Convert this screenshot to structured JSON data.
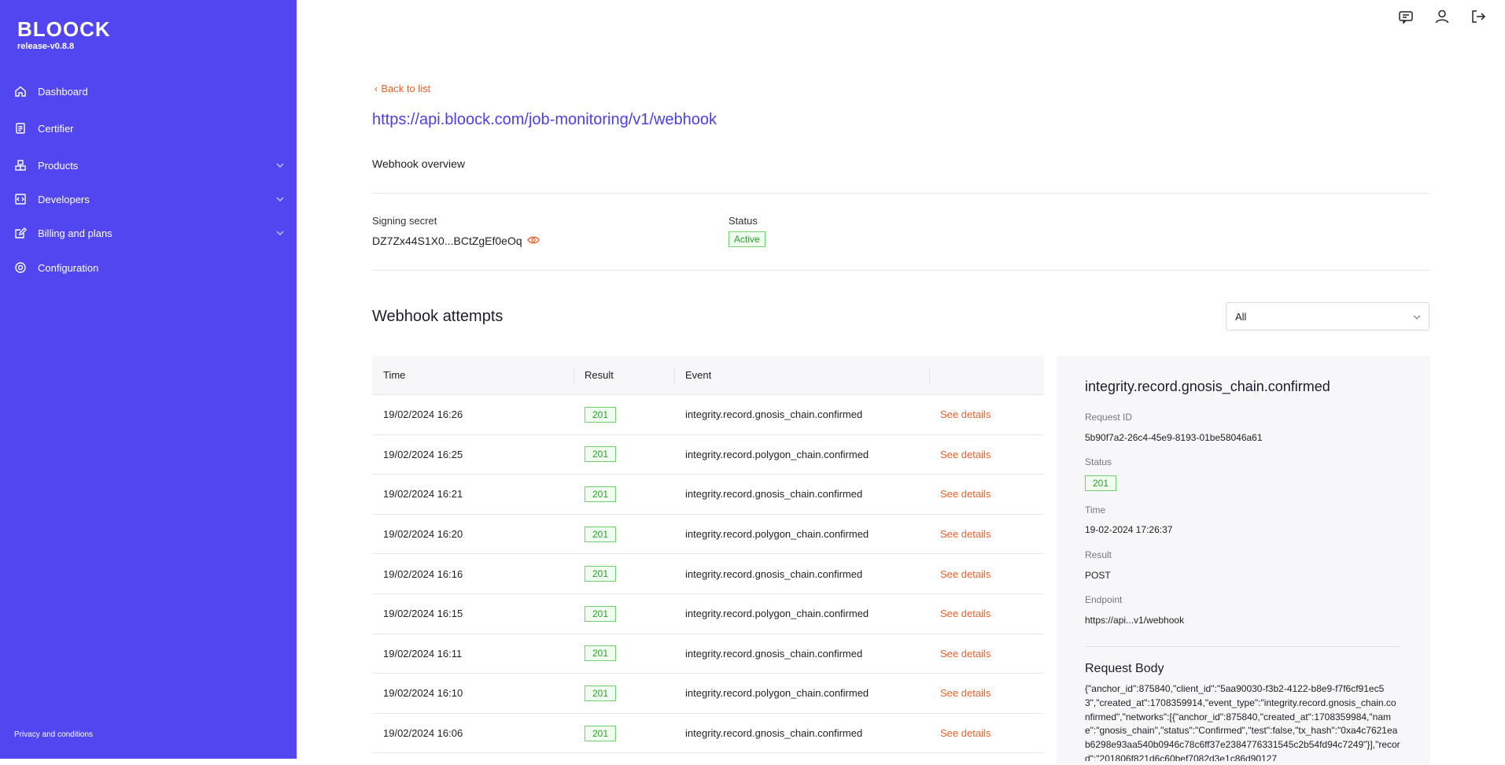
{
  "sidebar": {
    "logo": "BLOOCK",
    "version": "release-v0.8.8",
    "items": [
      {
        "label": "Dashboard",
        "icon": "home-icon",
        "expandable": false
      },
      {
        "label": "Certifier",
        "icon": "document-icon",
        "expandable": false
      },
      {
        "label": "Products",
        "icon": "cubes-icon",
        "expandable": true
      },
      {
        "label": "Developers",
        "icon": "code-icon",
        "expandable": true
      },
      {
        "label": "Billing and plans",
        "icon": "edit-icon",
        "expandable": true
      },
      {
        "label": "Configuration",
        "icon": "gear-icon",
        "expandable": false
      }
    ],
    "footer": "Privacy and conditions"
  },
  "topbar": {
    "icons": [
      "chat-icon",
      "user-icon",
      "logout-icon"
    ]
  },
  "main": {
    "back_label": "Back to list",
    "title": "https://api.bloock.com/job-monitoring/v1/webhook",
    "overview_title": "Webhook overview",
    "signing_secret_label": "Signing secret",
    "signing_secret_value": "DZ7Zx44S1X0...BCtZgEf0eOq",
    "status_label": "Status",
    "status_value": "Active",
    "attempts_title": "Webhook attempts",
    "filter": {
      "selected": "All"
    }
  },
  "table": {
    "headers": {
      "time": "Time",
      "result": "Result",
      "event": "Event"
    },
    "action_label": "See details",
    "rows": [
      {
        "time": "19/02/2024 16:26",
        "result": "201",
        "event": "integrity.record.gnosis_chain.confirmed"
      },
      {
        "time": "19/02/2024 16:25",
        "result": "201",
        "event": "integrity.record.polygon_chain.confirmed"
      },
      {
        "time": "19/02/2024 16:21",
        "result": "201",
        "event": "integrity.record.gnosis_chain.confirmed"
      },
      {
        "time": "19/02/2024 16:20",
        "result": "201",
        "event": "integrity.record.polygon_chain.confirmed"
      },
      {
        "time": "19/02/2024 16:16",
        "result": "201",
        "event": "integrity.record.gnosis_chain.confirmed"
      },
      {
        "time": "19/02/2024 16:15",
        "result": "201",
        "event": "integrity.record.polygon_chain.confirmed"
      },
      {
        "time": "19/02/2024 16:11",
        "result": "201",
        "event": "integrity.record.gnosis_chain.confirmed"
      },
      {
        "time": "19/02/2024 16:10",
        "result": "201",
        "event": "integrity.record.polygon_chain.confirmed"
      },
      {
        "time": "19/02/2024 16:06",
        "result": "201",
        "event": "integrity.record.gnosis_chain.confirmed"
      }
    ]
  },
  "details": {
    "title": "integrity.record.gnosis_chain.confirmed",
    "request_id_label": "Request ID",
    "request_id_value": "5b90f7a2-26c4-45e9-8193-01be58046a61",
    "status_label": "Status",
    "status_value": "201",
    "time_label": "Time",
    "time_value": "19-02-2024 17:26:37",
    "result_label": "Result",
    "result_value": "POST",
    "endpoint_label": "Endpoint",
    "endpoint_value": "https://api...v1/webhook",
    "body_title": "Request Body",
    "body_value": "{\"anchor_id\":875840,\"client_id\":\"5aa90030-f3b2-4122-b8e9-f7f6cf91ec53\",\"created_at\":1708359914,\"event_type\":\"integrity.record.gnosis_chain.confirmed\",\"networks\":[{\"anchor_id\":875840,\"created_at\":1708359984,\"name\":\"gnosis_chain\",\"status\":\"Confirmed\",\"test\":false,\"tx_hash\":\"0xa4c7621eab6298e93aa540b0946c78c6ff37e2384776331545c2b54fd94c7249\"}],\"record\":\"201806f821d6c60bef7082d3e1c86d90127"
  }
}
